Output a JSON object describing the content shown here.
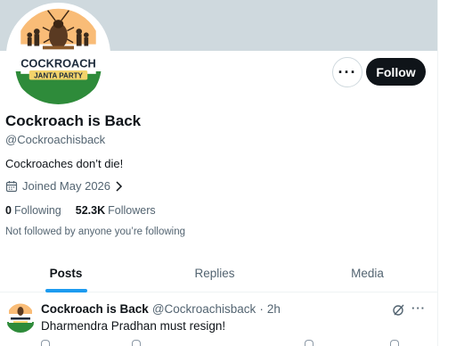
{
  "profile": {
    "display_name": "Cockroach is Back",
    "handle": "@Cockroachisback",
    "bio": "Cockroaches don’t die!",
    "joined": "Joined May 2026",
    "following_count": "0",
    "following_label": "Following",
    "followers_count": "52.3K",
    "followers_label": "Followers",
    "not_followed_text": "Not followed by anyone you’re following",
    "logo_text_main": "COCKROACH",
    "logo_text_sub": "JANTA PARTY"
  },
  "actions": {
    "follow_label": "Follow",
    "more_icon": "more-horizontal-icon"
  },
  "tabs": [
    {
      "label": "Posts",
      "active": true
    },
    {
      "label": "Replies",
      "active": false
    },
    {
      "label": "Media",
      "active": false
    }
  ],
  "post": {
    "name": "Cockroach is Back",
    "handle": "@Cockroachisback",
    "separator": "·",
    "time": "2h",
    "text": "Dharmendra Pradhan must resign!"
  },
  "colors": {
    "accent": "#1d9bf0",
    "text_primary": "#0f1419",
    "text_secondary": "#536471",
    "banner": "#cfd9de",
    "saffron": "#f28c28",
    "green": "#2e8b3a"
  }
}
